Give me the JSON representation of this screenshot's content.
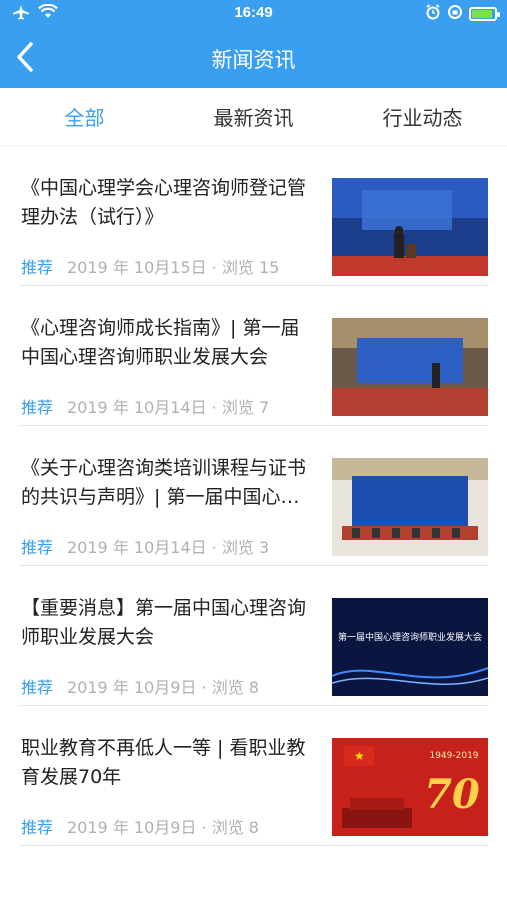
{
  "status_bar": {
    "time": "16:49"
  },
  "header": {
    "title": "新闻资讯"
  },
  "tabs": [
    {
      "label": "全部",
      "active": true
    },
    {
      "label": "最新资讯",
      "active": false
    },
    {
      "label": "行业动态",
      "active": false
    }
  ],
  "articles": [
    {
      "title": "《中国心理学会心理咨询师登记管理办法（试行）》",
      "tag": "推荐",
      "meta": "2019 年 10月15日 · 浏览 15"
    },
    {
      "title": "《心理咨询师成长指南》| 第一届中国心理咨询师职业发展大会",
      "tag": "推荐",
      "meta": "2019 年 10月14日 · 浏览 7"
    },
    {
      "title": "《关于心理咨询类培训课程与证书的共识与声明》| 第一届中国心理咨询师职业发展大会",
      "tag": "推荐",
      "meta": "2019 年 10月14日 · 浏览 3"
    },
    {
      "title": "【重要消息】第一届中国心理咨询师职业发展大会",
      "tag": "推荐",
      "meta": "2019 年 10月9日 · 浏览 8",
      "thumb_text": "第一届中国心理咨询师职业发展大会"
    },
    {
      "title": "职业教育不再低人一等 | 看职业教育发展70年",
      "tag": "推荐",
      "meta": "2019 年 10月9日 · 浏览 8",
      "thumb_text": "1949-2019",
      "thumb_big": "70"
    }
  ],
  "colors": {
    "accent": "#3a9ff0",
    "meta_gray": "#b0b0b0"
  }
}
